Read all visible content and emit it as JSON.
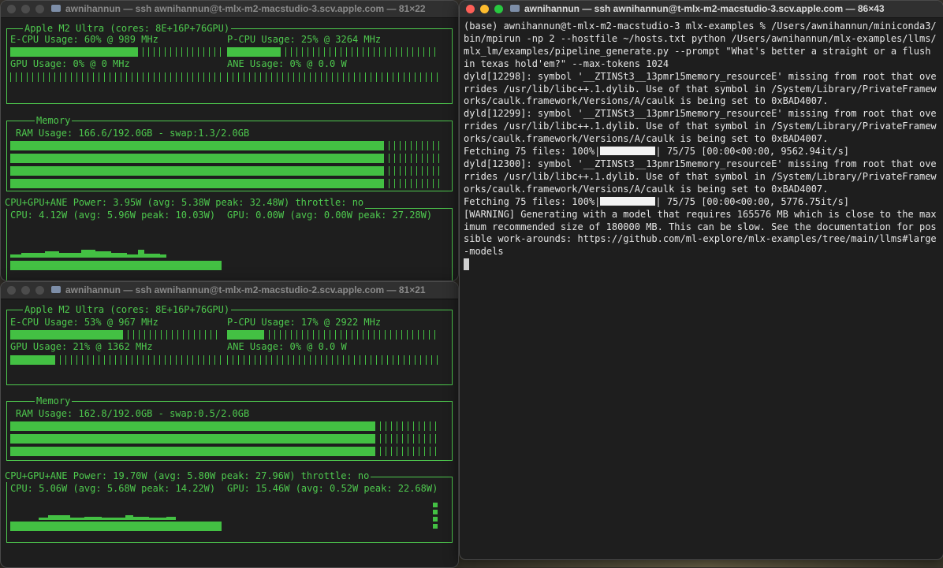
{
  "windows": {
    "top": {
      "title": "awnihannun — ssh awnihannun@t-mlx-m2-macstudio-3.scv.apple.com — 81×22",
      "chip": "Apple M2 Ultra (cores: 8E+16P+76GPU)",
      "ecpu": "E-CPU Usage: 60% @ 989 MHz",
      "ecpu_pct": 60,
      "pcpu": "P-CPU Usage: 25% @ 3264 MHz",
      "pcpu_pct": 25,
      "gpu": "GPU Usage: 0% @ 0 MHz",
      "gpu_pct": 0,
      "ane": "ANE Usage: 0% @ 0.0 W",
      "ane_pct": 0,
      "memory_label": "Memory",
      "ram": "RAM Usage: 166.6/192.0GB - swap:1.3/2.0GB",
      "ram_pct": 86.8,
      "power": "CPU+GPU+ANE Power: 3.95W (avg: 5.38W peak: 32.48W) throttle: no",
      "cpu_power": "CPU: 4.12W (avg: 5.96W peak: 10.03W)",
      "gpu_power": "GPU: 0.00W (avg: 0.00W peak: 27.28W)"
    },
    "bottom": {
      "title": "awnihannun — ssh awnihannun@t-mlx-m2-macstudio-2.scv.apple.com — 81×21",
      "chip": "Apple M2 Ultra (cores: 8E+16P+76GPU)",
      "ecpu": "E-CPU Usage: 53% @ 967 MHz",
      "ecpu_pct": 53,
      "pcpu": "P-CPU Usage: 17% @ 2922 MHz",
      "pcpu_pct": 17,
      "gpu": "GPU Usage: 21% @ 1362 MHz",
      "gpu_pct": 21,
      "ane": "ANE Usage: 0% @ 0.0 W",
      "ane_pct": 0,
      "memory_label": "Memory",
      "ram": "RAM Usage: 162.8/192.0GB - swap:0.5/2.0GB",
      "ram_pct": 84.8,
      "power": "CPU+GPU+ANE Power: 19.70W (avg: 5.80W peak: 27.96W) throttle: no",
      "cpu_power": "CPU: 5.06W (avg: 5.68W peak: 14.22W)",
      "gpu_power": "GPU: 15.46W (avg: 0.52W peak: 22.68W)"
    },
    "right": {
      "title": "awnihannun — ssh awnihannun@t-mlx-m2-macstudio-3.scv.apple.com — 86×43",
      "line1": "(base) awnihannun@t-mlx-m2-macstudio-3 mlx-examples % /Users/awnihannun/miniconda3/bin/mpirun -np 2 --hostfile ~/hosts.txt python /Users/awnihannun/mlx-examples/llms/mlx_lm/examples/pipeline_generate.py --prompt \"What's better a straight or a flush in texas hold'em?\" --max-tokens 1024",
      "line2": "dyld[12298]: symbol '__ZTINSt3__13pmr15memory_resourceE' missing from root that overrides /usr/lib/libc++.1.dylib. Use of that symbol in /System/Library/PrivateFrameworks/caulk.framework/Versions/A/caulk is being set to 0xBAD4007.",
      "line3": "dyld[12299]: symbol '__ZTINSt3__13pmr15memory_resourceE' missing from root that overrides /usr/lib/libc++.1.dylib. Use of that symbol in /System/Library/PrivateFrameworks/caulk.framework/Versions/A/caulk is being set to 0xBAD4007.",
      "fetch1_pre": "Fetching 75 files: 100%|",
      "fetch1_post": "| 75/75 [00:00<00:00, 9562.94it/s]",
      "line5": "dyld[12300]: symbol '__ZTINSt3__13pmr15memory_resourceE' missing from root that overrides /usr/lib/libc++.1.dylib. Use of that symbol in /System/Library/PrivateFrameworks/caulk.framework/Versions/A/caulk is being set to 0xBAD4007.",
      "fetch2_pre": "Fetching 75 files: 100%|",
      "fetch2_post": "| 75/75 [00:00<00:00, 5776.75it/s]",
      "line7": "[WARNING] Generating with a model that requires 165576 MB which is close to the maximum recommended size of 180000 MB. This can be slow. See the documentation for possible work-arounds: https://github.com/ml-explore/mlx-examples/tree/main/llms#large-models"
    }
  },
  "colors": {
    "accent": "#4ec94e",
    "terminal_bg": "#1e1e1e",
    "titlebar": "#303030"
  }
}
